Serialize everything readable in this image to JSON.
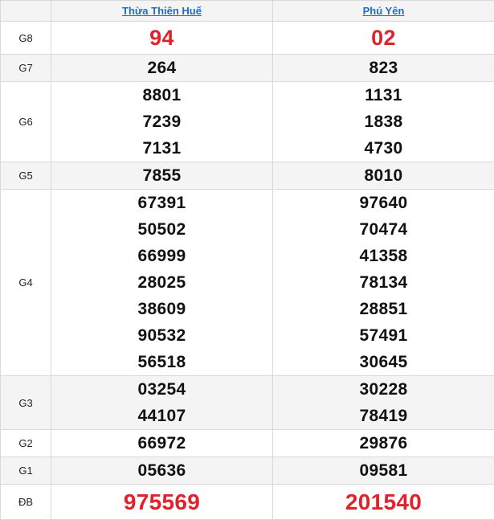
{
  "provinces": [
    "Thừa Thiên Huế",
    "Phú Yên"
  ],
  "accent_red": "#e0232b",
  "link_blue": "#1a6fc9",
  "rows": [
    {
      "label": "G8",
      "style": "g8",
      "alt": false,
      "values": [
        [
          "94"
        ],
        [
          "02"
        ]
      ]
    },
    {
      "label": "G7",
      "style": "",
      "alt": true,
      "values": [
        [
          "264"
        ],
        [
          "823"
        ]
      ]
    },
    {
      "label": "G6",
      "style": "",
      "alt": false,
      "values": [
        [
          "8801",
          "7239",
          "7131"
        ],
        [
          "1131",
          "1838",
          "4730"
        ]
      ]
    },
    {
      "label": "G5",
      "style": "",
      "alt": true,
      "values": [
        [
          "7855"
        ],
        [
          "8010"
        ]
      ]
    },
    {
      "label": "G4",
      "style": "",
      "alt": false,
      "values": [
        [
          "67391",
          "50502",
          "66999",
          "28025",
          "38609",
          "90532",
          "56518"
        ],
        [
          "97640",
          "70474",
          "41358",
          "78134",
          "28851",
          "57491",
          "30645"
        ]
      ]
    },
    {
      "label": "G3",
      "style": "",
      "alt": true,
      "values": [
        [
          "03254",
          "44107"
        ],
        [
          "30228",
          "78419"
        ]
      ]
    },
    {
      "label": "G2",
      "style": "",
      "alt": false,
      "values": [
        [
          "66972"
        ],
        [
          "29876"
        ]
      ]
    },
    {
      "label": "G1",
      "style": "",
      "alt": true,
      "values": [
        [
          "05636"
        ],
        [
          "09581"
        ]
      ]
    },
    {
      "label": "ĐB",
      "style": "db",
      "alt": false,
      "values": [
        [
          "975569"
        ],
        [
          "201540"
        ]
      ]
    }
  ]
}
